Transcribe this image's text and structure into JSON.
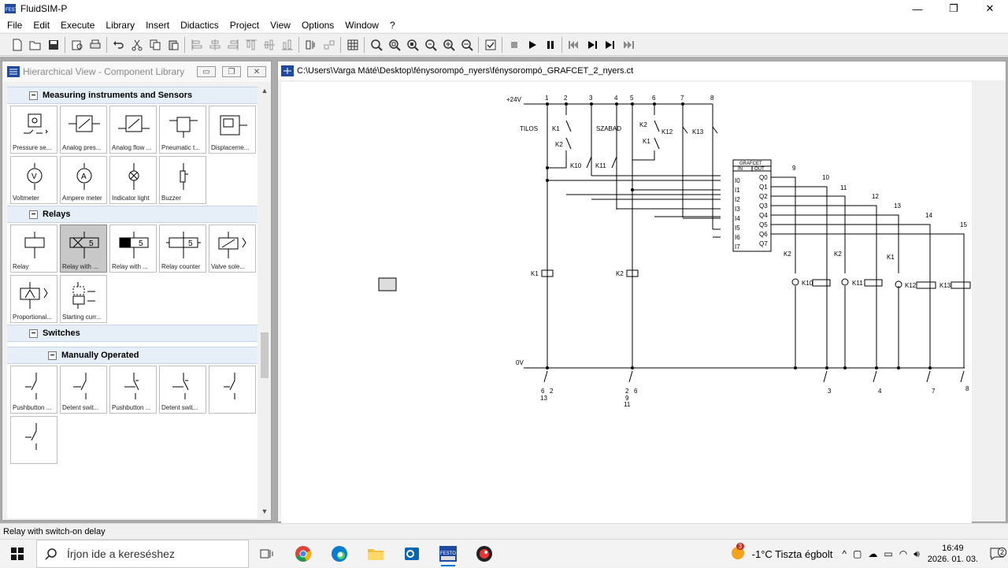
{
  "app": {
    "title": "FluidSIM-P"
  },
  "window_controls": {
    "minimize": "—",
    "maximize": "❐",
    "close": "✕"
  },
  "menu": [
    "File",
    "Edit",
    "Execute",
    "Library",
    "Insert",
    "Didactics",
    "Project",
    "View",
    "Options",
    "Window",
    "?"
  ],
  "library": {
    "title": "Hierarchical View - Component Library",
    "categories": [
      {
        "name": "Measuring instruments and Sensors",
        "items": [
          "Pressure se...",
          "Analog pres...",
          "Analog flow ...",
          "Pneumatic t...",
          "Displaceme...",
          "Voltmeter",
          "Ampere meter",
          "Indicator light",
          "Buzzer"
        ]
      },
      {
        "name": "Relays",
        "items": [
          "Relay",
          "Relay with ...",
          "Relay with ...",
          "Relay counter",
          "Valve sole...",
          "Proportional...",
          "Starting curr..."
        ]
      },
      {
        "name": "Switches",
        "items": []
      },
      {
        "name": "Manually Operated",
        "items": [
          "Pushbutton ...",
          "Detent swit...",
          "Pushbutton ...",
          "Detent swit..."
        ]
      }
    ]
  },
  "circuit": {
    "path": "C:\\Users\\Varga Máté\\Desktop\\fénysorompó_nyers\\fénysorompó_GRAFCET_2_nyers.ct",
    "supply_top": "+24V",
    "supply_bottom": "0V",
    "columns": [
      "1",
      "2",
      "3",
      "4",
      "5",
      "6",
      "7",
      "8"
    ],
    "right_columns": [
      "9",
      "10",
      "11",
      "12",
      "13",
      "14",
      "15"
    ],
    "labels": {
      "tilos": "TILOS",
      "szabad": "SZABAD",
      "grafcet": "GRAFCET",
      "in": "IN",
      "out": "OUT"
    },
    "inputs": [
      "I0",
      "I1",
      "I2",
      "I3",
      "I4",
      "I5",
      "I6",
      "I7"
    ],
    "outputs": [
      "Q0",
      "Q1",
      "Q2",
      "Q3",
      "Q4",
      "Q5",
      "Q6",
      "Q7"
    ],
    "relays": [
      "K1",
      "K2",
      "K10",
      "K11",
      "K12",
      "K13"
    ],
    "bottom_refs": [
      {
        "a": "6",
        "b": "2",
        "c": "13"
      },
      {
        "a": "2",
        "b": "6",
        "c": "9",
        "d": "11"
      },
      {
        "c": "3"
      },
      {
        "c": "4"
      },
      {
        "c": "7"
      },
      {
        "c": "8"
      }
    ]
  },
  "status": {
    "text": "Relay with switch-on delay"
  },
  "taskbar": {
    "search_placeholder": "Írjon ide a kereséshez",
    "weather": "-1°C  Tiszta égbolt",
    "weather_badge": "3",
    "time": "16:49",
    "date": "2026. 01. 03.",
    "notifications": "2"
  }
}
